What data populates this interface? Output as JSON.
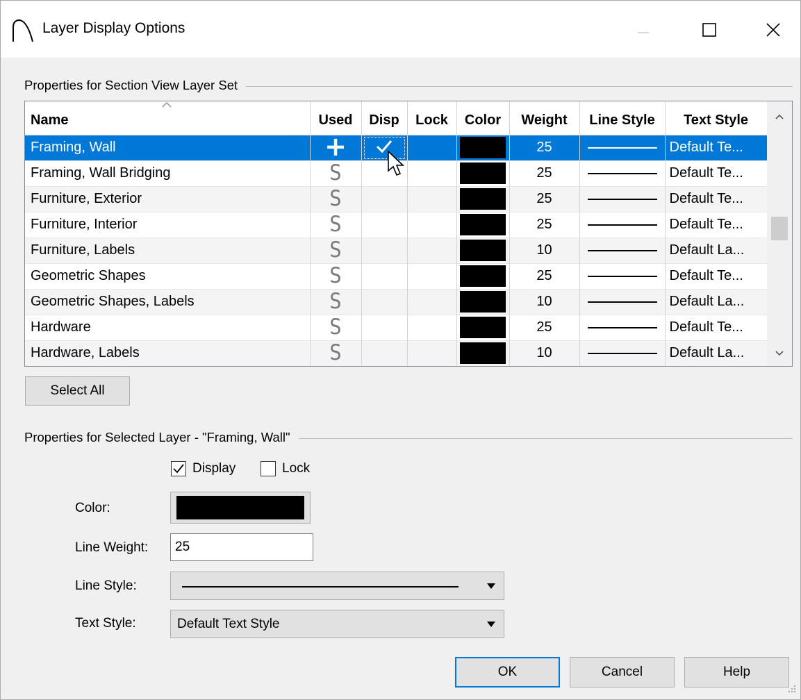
{
  "window": {
    "title": "Layer Display Options",
    "minimize_icon": "minimize-icon",
    "maximize_icon": "maximize-icon",
    "close_icon": "close-icon",
    "app_icon": "arch-icon"
  },
  "layer_set": {
    "group_label": "Properties for Section View Layer Set",
    "columns": [
      "Name",
      "Used",
      "Disp",
      "Lock",
      "Color",
      "Weight",
      "Line Style",
      "Text Style"
    ],
    "rows": [
      {
        "name": "Framing, Wall",
        "used": "+",
        "disp": true,
        "lock": false,
        "color": "#000000",
        "weight": "25",
        "text_style": "Default Te...",
        "selected": true
      },
      {
        "name": "Framing, Wall Bridging",
        "used": "S",
        "disp": false,
        "lock": false,
        "color": "#000000",
        "weight": "25",
        "text_style": "Default Te..."
      },
      {
        "name": "Furniture, Exterior",
        "used": "S",
        "disp": false,
        "lock": false,
        "color": "#000000",
        "weight": "25",
        "text_style": "Default Te..."
      },
      {
        "name": "Furniture, Interior",
        "used": "S",
        "disp": false,
        "lock": false,
        "color": "#000000",
        "weight": "25",
        "text_style": "Default Te..."
      },
      {
        "name": "Furniture, Labels",
        "used": "S",
        "disp": false,
        "lock": false,
        "color": "#000000",
        "weight": "10",
        "text_style": "Default La..."
      },
      {
        "name": "Geometric Shapes",
        "used": "S",
        "disp": false,
        "lock": false,
        "color": "#000000",
        "weight": "25",
        "text_style": "Default Te..."
      },
      {
        "name": "Geometric Shapes, Labels",
        "used": "S",
        "disp": false,
        "lock": false,
        "color": "#000000",
        "weight": "10",
        "text_style": "Default La..."
      },
      {
        "name": "Hardware",
        "used": "S",
        "disp": false,
        "lock": false,
        "color": "#000000",
        "weight": "25",
        "text_style": "Default Te..."
      },
      {
        "name": "Hardware, Labels",
        "used": "S",
        "disp": false,
        "lock": false,
        "color": "#000000",
        "weight": "10",
        "text_style": "Default La..."
      }
    ],
    "select_all_label": "Select All"
  },
  "selected_layer": {
    "group_label": "Properties for Selected Layer - \"Framing, Wall\"",
    "display_label": "Display",
    "display_checked": true,
    "lock_label": "Lock",
    "lock_checked": false,
    "color_label": "Color:",
    "color_value": "#000000",
    "line_weight_label": "Line Weight:",
    "line_weight_value": "25",
    "line_style_label": "Line Style:",
    "text_style_label": "Text Style:",
    "text_style_value": "Default Text Style"
  },
  "buttons": {
    "ok": "OK",
    "cancel": "Cancel",
    "help": "Help"
  },
  "colors": {
    "selection": "#0078d7",
    "dialog_bg": "#f0f0f0"
  }
}
